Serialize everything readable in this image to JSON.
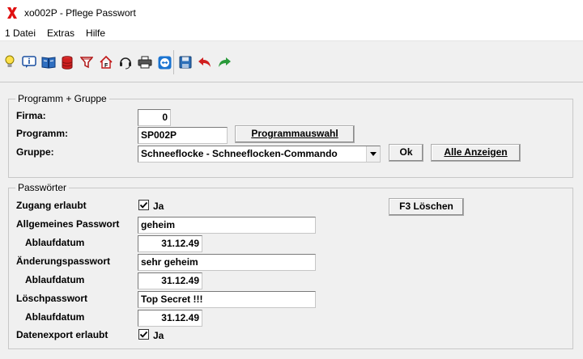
{
  "window": {
    "title": "xo002P - Pflege Passwort"
  },
  "menu": {
    "items": [
      "1 Datei",
      "Extras",
      "Hilfe"
    ]
  },
  "toolbar": {
    "icons": [
      "lightbulb-icon",
      "info-icon",
      "book-icon",
      "database-icon",
      "filter-icon",
      "home-icon",
      "headset-icon",
      "printer-icon",
      "teamviewer-icon",
      "save-icon",
      "undo-icon",
      "redo-icon"
    ]
  },
  "programm_gruppe": {
    "title": "Programm + Gruppe",
    "firma_label": "Firma:",
    "firma_value": "0",
    "programm_label": "Programm:",
    "programm_value": "SP002P",
    "programmauswahl_button": "Programmauswahl",
    "gruppe_label": "Gruppe:",
    "gruppe_value": "Schneeflocke - Schneeflocken-Commando",
    "ok_button": "Ok",
    "alle_anzeigen_button": "Alle Anzeigen"
  },
  "passwoerter": {
    "title": "Passwörter",
    "zugang_label": "Zugang erlaubt",
    "zugang_checkbox_label": "Ja",
    "zugang_checked": true,
    "f3_button": "F3 Löschen",
    "allgemein_label": "Allgemeines Passwort",
    "allgemein_value": "geheim",
    "ablauf1_label": "Ablaufdatum",
    "ablauf1_value": "31.12.49",
    "aenderung_label": "Änderungspasswort",
    "aenderung_value": "sehr geheim",
    "ablauf2_label": "Ablaufdatum",
    "ablauf2_value": "31.12.49",
    "loesch_label": "Löschpasswort",
    "loesch_value": "Top Secret !!!",
    "ablauf3_label": "Ablaufdatum",
    "ablauf3_value": "31.12.49",
    "export_label": "Datenexport erlaubt",
    "export_checkbox_label": "Ja",
    "export_checked": true
  },
  "colors": {
    "logo_red": "#e01010",
    "undo_red": "#d02020",
    "redo_green": "#2a9a3a",
    "save_blue": "#2d6fb8"
  }
}
